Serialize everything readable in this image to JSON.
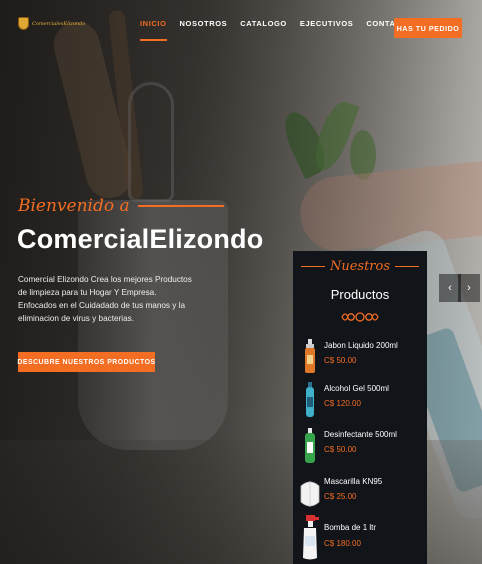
{
  "header": {
    "logo_text": "ComercialesElizondo",
    "nav": [
      "INICIO",
      "NOSOTROS",
      "CATALOGO",
      "EJECUTIVOS",
      "CONTACTANOS"
    ],
    "order_button": "HAS TU PEDIDO"
  },
  "hero": {
    "welcome": "Bienvenido a",
    "title": "ComercialElizondo",
    "description": "Comercial Elizondo Crea los mejores Productos de limpieza para tu Hogar Y Empresa. Enfocados en el Cuidadado de tus manos y la eliminacion de virus y bacterias.",
    "cta": "DESCUBRE NUESTROS PRODUCTOS"
  },
  "slider": {
    "prev_icon": "‹",
    "next_icon": "›"
  },
  "products_card": {
    "script": "Nuestros",
    "title": "Productos",
    "items": [
      {
        "name": "Jabon Liquido 200ml",
        "price": "C$ 50.00",
        "icon": "soap-bottle-icon"
      },
      {
        "name": "Alcohol Gel 500ml",
        "price": "C$ 120.00",
        "icon": "gel-bottle-icon"
      },
      {
        "name": "Desinfectante 500ml",
        "price": "C$ 50.00",
        "icon": "disinfectant-bottle-icon"
      },
      {
        "name": "Mascarilla KN95",
        "price": "C$ 25.00",
        "icon": "mask-icon"
      },
      {
        "name": "Bomba de 1 ltr",
        "price": "C$ 180.00",
        "icon": "spray-bottle-icon"
      }
    ]
  },
  "colors": {
    "accent": "#f36d22",
    "card_bg": "#111418",
    "text": "#ffffff"
  }
}
